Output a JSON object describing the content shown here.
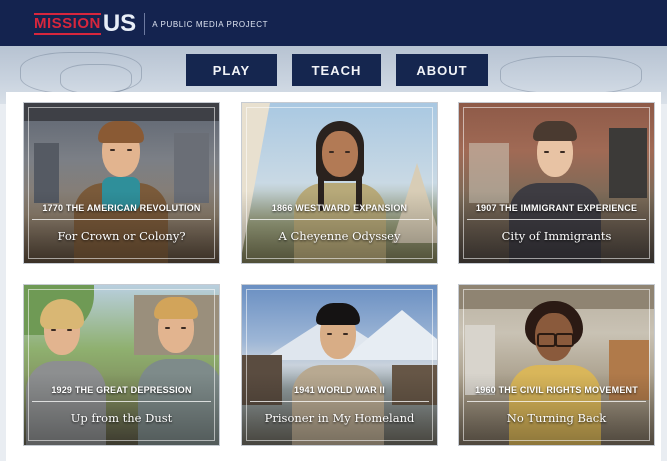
{
  "header": {
    "logo_mission": "MISSION",
    "logo_us": "US",
    "tagline": "A PUBLIC MEDIA PROJECT"
  },
  "nav": {
    "play": "PLAY",
    "teach": "TEACH",
    "about": "ABOUT"
  },
  "missions": [
    {
      "era": "1770 THE AMERICAN REVOLUTION",
      "title": "For Crown or Colony?"
    },
    {
      "era": "1866 WESTWARD EXPANSION",
      "title": "A Cheyenne Odyssey"
    },
    {
      "era": "1907 THE IMMIGRANT EXPERIENCE",
      "title": "City of Immigrants"
    },
    {
      "era": "1929 THE GREAT DEPRESSION",
      "title": "Up from the Dust"
    },
    {
      "era": "1941 WORLD WAR II",
      "title": "Prisoner in My Homeland"
    },
    {
      "era": "1960 THE CIVIL RIGHTS MOVEMENT",
      "title": "No Turning Back"
    }
  ],
  "colors": {
    "header_bg": "#14234f",
    "brand_red": "#d7263d",
    "nav_bg": "#15264f"
  }
}
